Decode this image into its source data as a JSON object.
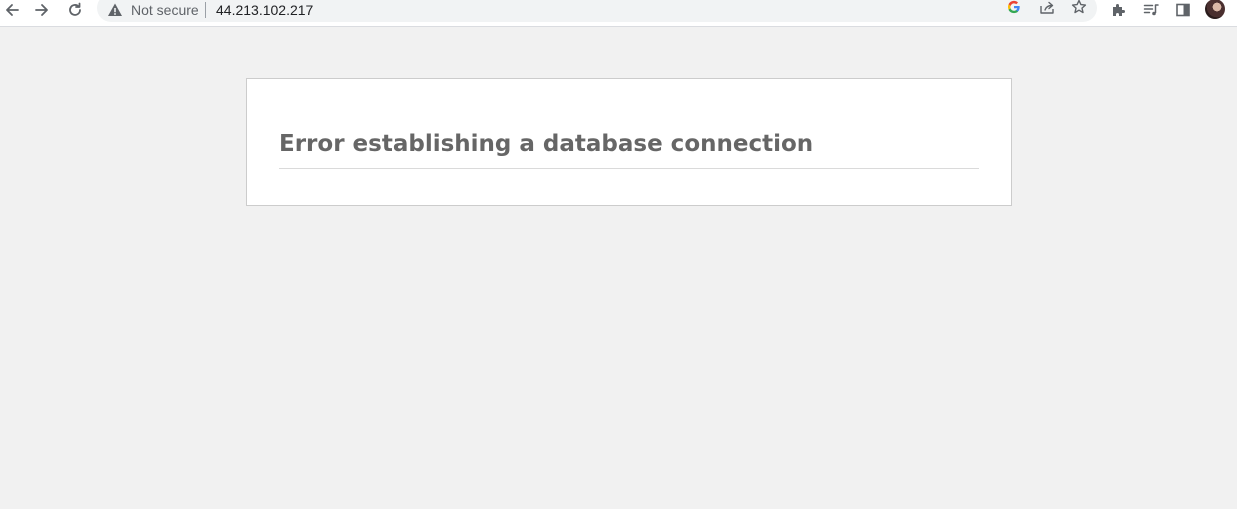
{
  "browser": {
    "security_label": "Not secure",
    "url": "44.213.102.217",
    "icons": {
      "back": "back-arrow-icon",
      "forward": "forward-arrow-icon",
      "reload": "reload-icon",
      "warning": "warning-triangle-icon",
      "google": "google-icon",
      "share": "share-icon",
      "bookmark": "star-icon",
      "extensions": "puzzle-icon",
      "reading_list": "reading-list-icon",
      "side_panel": "side-panel-icon",
      "profile": "avatar"
    }
  },
  "page": {
    "error_message": "Error establishing a database connection"
  },
  "colors": {
    "page_background": "#f1f1f1",
    "card_background": "#ffffff",
    "card_border": "#cccccc",
    "heading_text": "#666666"
  }
}
